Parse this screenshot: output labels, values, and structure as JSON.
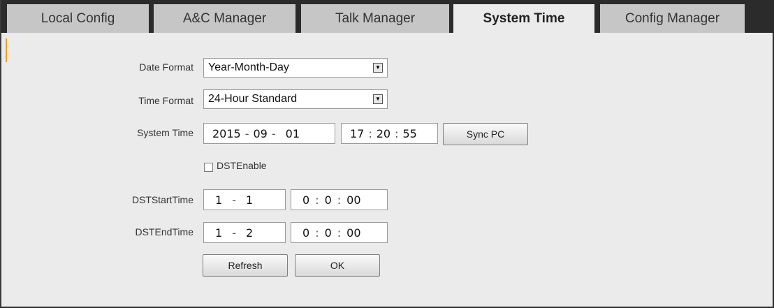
{
  "tabs": [
    {
      "label": "Local Config"
    },
    {
      "label": "A&C Manager"
    },
    {
      "label": "Talk Manager"
    },
    {
      "label": "System Time",
      "active": true
    },
    {
      "label": "Config Manager"
    }
  ],
  "form": {
    "date_format": {
      "label": "Date Format",
      "value": "Year-Month-Day"
    },
    "time_format": {
      "label": "Time Format",
      "value": "24-Hour Standard"
    },
    "system_time": {
      "label": "System Time",
      "year": "2015",
      "month": "09",
      "day": "01",
      "hour": "17",
      "minute": "20",
      "second": "55",
      "date_sep": "-",
      "time_sep": ":"
    },
    "sync_pc": "Sync PC",
    "dst_enable": {
      "label": "DSTEnable",
      "checked": false
    },
    "dst_start": {
      "label": "DSTStartTime",
      "month": "1",
      "day": "1",
      "hour": "0",
      "minute": "0",
      "second": "00"
    },
    "dst_end": {
      "label": "DSTEndTime",
      "month": "1",
      "day": "2",
      "hour": "0",
      "minute": "0",
      "second": "00"
    },
    "refresh": "Refresh",
    "ok": "OK"
  },
  "colors": {
    "active_tab_bg": "#ebebeb",
    "tab_bg": "#c6c6c6",
    "tabbar_bg": "#2b2b2b",
    "accent": "#f0a020"
  },
  "icons": {
    "dropdown": "chevron-down-icon",
    "checkbox": "checkbox-icon"
  }
}
